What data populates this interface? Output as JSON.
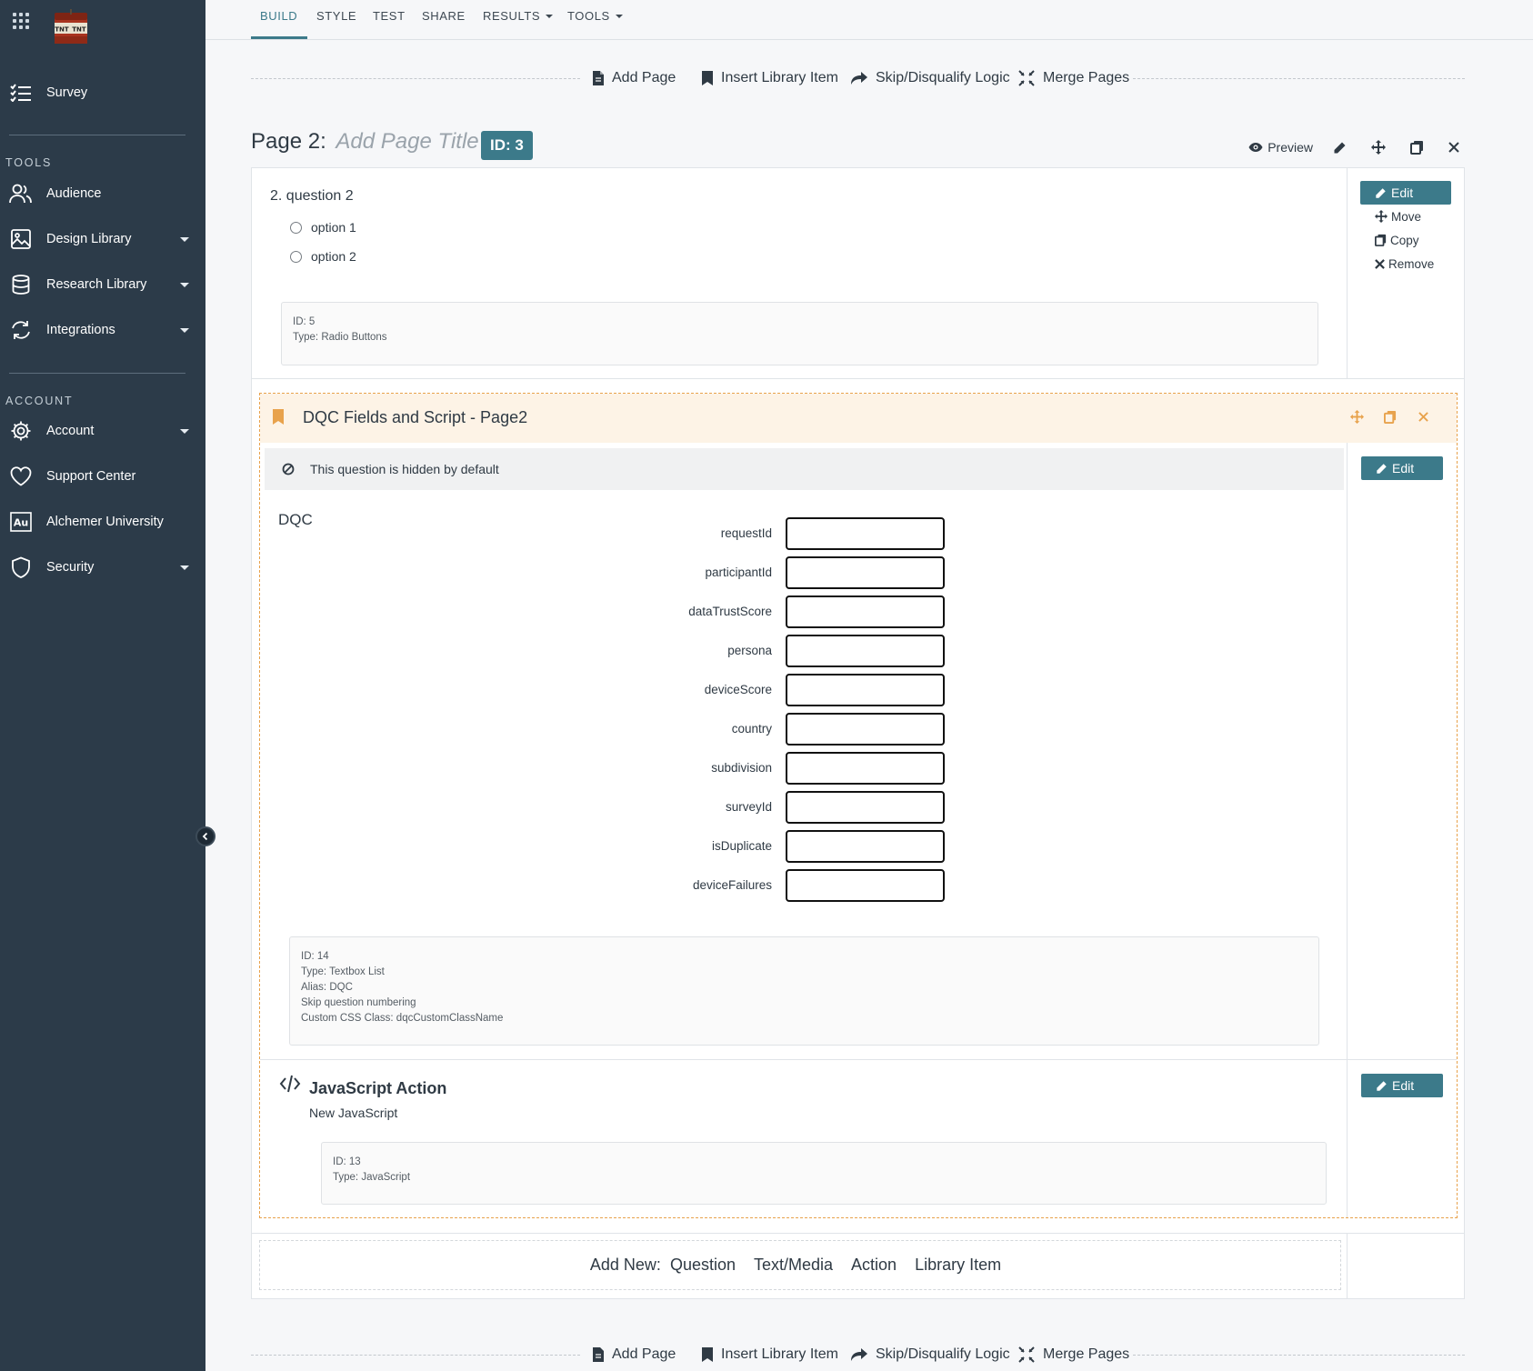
{
  "sidebar": {
    "logo_text": [
      "TNT",
      "TNT"
    ],
    "items": [
      {
        "label": "Survey",
        "icon": "list-check-icon"
      },
      {
        "label": "Audience",
        "icon": "users-icon"
      },
      {
        "label": "Design Library",
        "icon": "image-icon"
      },
      {
        "label": "Research Library",
        "icon": "database-icon"
      },
      {
        "label": "Integrations",
        "icon": "sync-icon"
      },
      {
        "label": "Account",
        "icon": "gear-icon"
      },
      {
        "label": "Support Center",
        "icon": "heart-icon"
      },
      {
        "label": "Alchemer University",
        "icon": "au-icon"
      },
      {
        "label": "Security",
        "icon": "shield-icon"
      }
    ],
    "tools_heading": "TOOLS",
    "account_heading": "ACCOUNT",
    "au_glyph": "Au"
  },
  "topnav": {
    "tabs": [
      "BUILD",
      "STYLE",
      "TEST",
      "SHARE",
      "RESULTS",
      "TOOLS"
    ],
    "active": "BUILD"
  },
  "page_tools": {
    "add_page": "Add Page",
    "insert_library_item": "Insert Library Item",
    "skip_logic": "Skip/Disqualify Logic",
    "merge_pages": "Merge Pages"
  },
  "page": {
    "title_prefix": "Page 2:",
    "title_placeholder": "Add Page Title",
    "id_badge": "ID: 3",
    "preview": "Preview"
  },
  "question2": {
    "title": "2. question 2",
    "options": [
      "option 1",
      "option 2"
    ],
    "meta": [
      "ID: 5",
      "Type: Radio Buttons"
    ],
    "actions": {
      "edit": "Edit",
      "move": "Move",
      "copy": "Copy",
      "remove": "Remove"
    }
  },
  "library_item": {
    "title": "DQC Fields and Script - Page2",
    "hidden_notice": "This question is hidden by default",
    "edit": "Edit",
    "dqc_label": "DQC",
    "fields": [
      "requestId",
      "participantId",
      "dataTrustScore",
      "persona",
      "deviceScore",
      "country",
      "subdivision",
      "surveyId",
      "isDuplicate",
      "deviceFailures"
    ],
    "meta": [
      "ID: 14",
      "Type: Textbox List",
      "Alias: DQC",
      "Skip question numbering",
      "Custom CSS Class: dqcCustomClassName"
    ]
  },
  "js_action": {
    "title": "JavaScript Action",
    "subtitle": "New JavaScript",
    "edit": "Edit",
    "meta": [
      "ID: 13",
      "Type: JavaScript"
    ]
  },
  "add_new": {
    "label": "Add New:",
    "options": [
      "Question",
      "Text/Media",
      "Action",
      "Library Item"
    ]
  },
  "colors": {
    "sidebar_bg": "#2c3b49",
    "accent": "#3c7a8a",
    "library_accent": "#e8a24c"
  }
}
